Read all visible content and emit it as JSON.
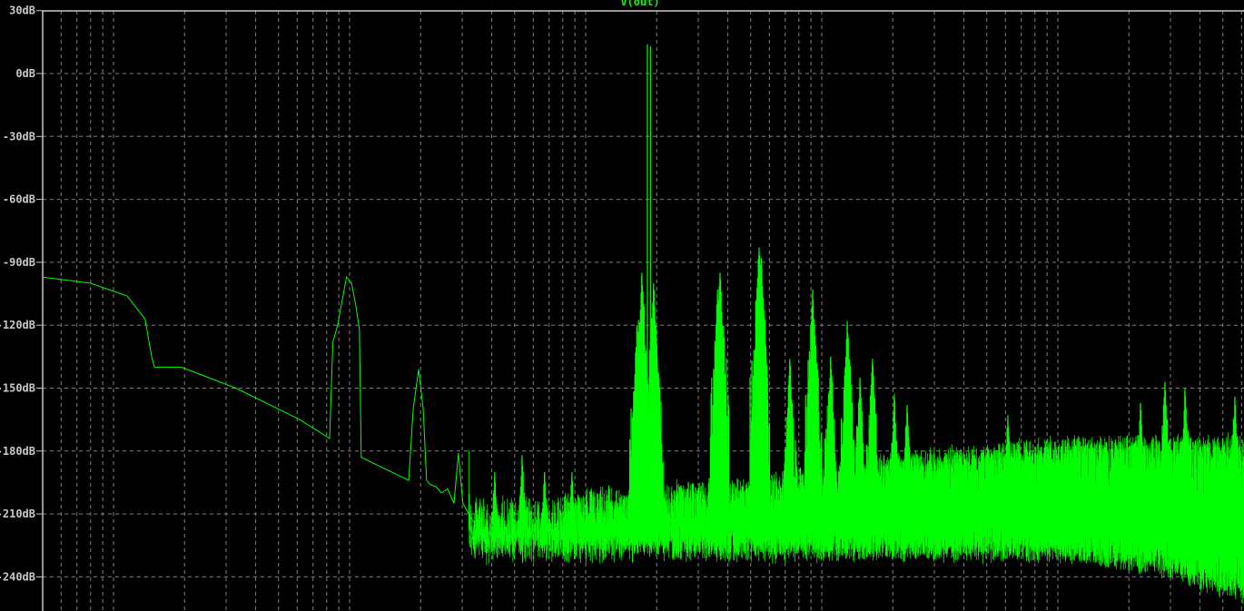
{
  "chart_data": {
    "type": "line",
    "title": "V(out)",
    "xlabel": "",
    "ylabel": "",
    "x_scale": "log",
    "x_unit_note": "unlabeled; values relative to first decade gridline = 1",
    "xlim": [
      0.5,
      61000
    ],
    "ylim": [
      -256,
      30
    ],
    "y_ticks": [
      30,
      0,
      -30,
      -60,
      -90,
      -120,
      -150,
      -180,
      -210,
      -240
    ],
    "y_tick_labels": [
      "30dB",
      "0dB",
      "-30dB",
      "-60dB",
      "-90dB",
      "-120dB",
      "-150dB",
      "-180dB",
      "-210dB",
      "-240dB"
    ],
    "grid": true,
    "colors": {
      "trace": "#00ff00",
      "grid": "#808080",
      "axis": "#c8c8c8",
      "background": "#000000"
    },
    "series": [
      {
        "name": "V(out)",
        "points": [
          [
            0.5,
            -97
          ],
          [
            0.8,
            -100
          ],
          [
            1.14,
            -106
          ],
          [
            1.36,
            -117
          ],
          [
            1.45,
            -135
          ],
          [
            1.49,
            -140
          ],
          [
            1.94,
            -140
          ],
          [
            3.3,
            -150
          ],
          [
            6.14,
            -165
          ],
          [
            8.23,
            -174
          ],
          [
            8.5,
            -128
          ],
          [
            8.9,
            -120
          ],
          [
            9.7,
            -97
          ],
          [
            10.2,
            -100
          ],
          [
            10.6,
            -110
          ],
          [
            11.0,
            -122
          ],
          [
            11.2,
            -183
          ],
          [
            17.8,
            -194
          ],
          [
            18.6,
            -160
          ],
          [
            19.6,
            -141
          ],
          [
            20.5,
            -160
          ],
          [
            21.2,
            -194
          ],
          [
            22.0,
            -196
          ],
          [
            23.2,
            -197
          ],
          [
            24.5,
            -200
          ],
          [
            26,
            -198
          ],
          [
            27.7,
            -205
          ],
          [
            28.9,
            -181
          ],
          [
            30.2,
            -205
          ],
          [
            32,
            -210
          ],
          [
            34,
            -215
          ]
        ]
      }
    ],
    "spikes": [
      [
        182.6,
        14
      ],
      [
        188,
        13
      ],
      [
        173,
        -95
      ],
      [
        194,
        -100
      ],
      [
        165,
        -120
      ],
      [
        200,
        -130
      ],
      [
        371,
        -95
      ],
      [
        362,
        -103
      ],
      [
        543,
        -83
      ],
      [
        555,
        -88
      ],
      [
        916,
        -103
      ],
      [
        733,
        -136
      ],
      [
        1282,
        -118
      ],
      [
        1092,
        -135
      ],
      [
        1641,
        -136
      ],
      [
        1452,
        -145
      ],
      [
        2031,
        -153
      ],
      [
        2300,
        -158
      ],
      [
        6143,
        -163
      ],
      [
        28430,
        -147
      ],
      [
        34550,
        -150
      ],
      [
        56230,
        -154
      ],
      [
        22390,
        -157
      ],
      [
        53.8,
        -182
      ],
      [
        67,
        -190
      ],
      [
        87.5,
        -190
      ],
      [
        41.2,
        -190
      ]
    ],
    "noise_floor": {
      "start": 32,
      "upper": [
        [
          32,
          -200
        ],
        [
          150,
          -195
        ],
        [
          500,
          -190
        ],
        [
          1600,
          -180
        ],
        [
          9000,
          -172
        ],
        [
          61000,
          -170
        ]
      ],
      "lower": [
        [
          32,
          -228
        ],
        [
          150,
          -226
        ],
        [
          1200,
          -226
        ],
        [
          9000,
          -226
        ],
        [
          25000,
          -232
        ],
        [
          61000,
          -246
        ]
      ]
    }
  }
}
